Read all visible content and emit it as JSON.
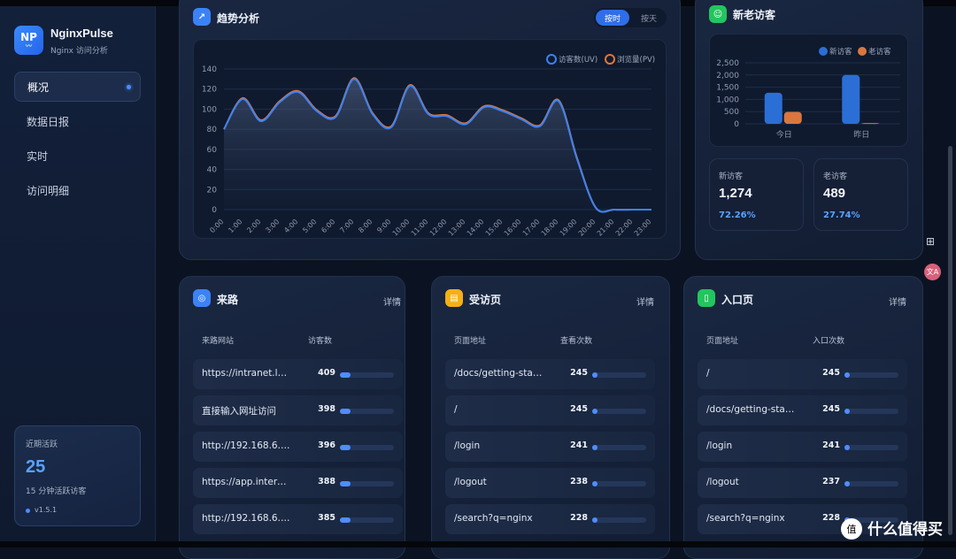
{
  "brand": {
    "logo": "NP",
    "title": "NginxPulse",
    "subtitle": "Nginx 访问分析"
  },
  "nav": [
    {
      "label": "概况",
      "active": true
    },
    {
      "label": "数据日报",
      "active": false
    },
    {
      "label": "实时",
      "active": false
    },
    {
      "label": "访问明细",
      "active": false
    }
  ],
  "recent": {
    "label": "近期活跃",
    "value": "25",
    "sub": "15 分钟活跃访客",
    "version": "v1.5.1"
  },
  "trend": {
    "title": "趋势分析",
    "seg_on": "按时",
    "seg_off": "按天"
  },
  "chart_data": {
    "type": "area",
    "legend": [
      "访客数(UV)",
      "浏览量(PV)"
    ],
    "x": [
      "0:00",
      "1:00",
      "2:00",
      "3:00",
      "4:00",
      "5:00",
      "6:00",
      "7:00",
      "8:00",
      "9:00",
      "10:00",
      "11:00",
      "12:00",
      "13:00",
      "14:00",
      "15:00",
      "16:00",
      "17:00",
      "18:00",
      "19:00",
      "20:00",
      "21:00",
      "22:00",
      "23:00"
    ],
    "ylim": [
      0,
      140
    ],
    "yticks": [
      0,
      20,
      40,
      60,
      80,
      100,
      120,
      140
    ],
    "series": [
      {
        "name": "访客数(UV)",
        "color": "#3b82f6",
        "values": [
          80,
          110,
          88,
          107,
          117,
          98,
          92,
          130,
          95,
          82,
          123,
          95,
          93,
          85,
          102,
          98,
          90,
          83,
          108,
          50,
          2,
          0,
          0,
          0
        ]
      },
      {
        "name": "浏览量(PV)",
        "color": "#e0773a",
        "values": [
          80,
          111,
          89,
          108,
          118,
          99,
          93,
          131,
          96,
          83,
          124,
          96,
          94,
          86,
          103,
          99,
          91,
          84,
          109,
          51,
          2,
          0,
          0,
          0
        ]
      }
    ]
  },
  "visitors": {
    "title": "新老访客",
    "legend_new": "新访客",
    "legend_old": "老访客",
    "chart_data": {
      "type": "bar",
      "categories": [
        "今日",
        "昨日"
      ],
      "ylim": [
        0,
        2500
      ],
      "yticks": [
        "0",
        "500",
        "1,000",
        "1,500",
        "2,000",
        "2,500"
      ],
      "series": [
        {
          "name": "新访客",
          "color": "#2b6fd6",
          "values": [
            1274,
            2000
          ]
        },
        {
          "name": "老访客",
          "color": "#d9773f",
          "values": [
            489,
            30
          ]
        }
      ]
    },
    "new": {
      "label": "新访客",
      "value": "1,274",
      "pct": "72.26%"
    },
    "old": {
      "label": "老访客",
      "value": "489",
      "pct": "27.74%"
    }
  },
  "source": {
    "title": "来路",
    "detail": "详情",
    "col1": "来路网站",
    "col2": "访客数",
    "rows": [
      {
        "name": "https://intranet.loc...",
        "value": "409",
        "fill": 0.2
      },
      {
        "name": "直接输入网址访问",
        "value": "398",
        "fill": 0.2
      },
      {
        "name": "http://192.168.6.131...",
        "value": "396",
        "fill": 0.2
      },
      {
        "name": "https://app.interna...",
        "value": "388",
        "fill": 0.2
      },
      {
        "name": "http://192.168.6.131...",
        "value": "385",
        "fill": 0.2
      }
    ]
  },
  "pages": {
    "title": "受访页",
    "detail": "详情",
    "col1": "页面地址",
    "col2": "查看次数",
    "rows": [
      {
        "name": "/docs/getting-star...",
        "value": "245",
        "fill": 0.1
      },
      {
        "name": "/",
        "value": "245",
        "fill": 0.1
      },
      {
        "name": "/login",
        "value": "241",
        "fill": 0.1
      },
      {
        "name": "/logout",
        "value": "238",
        "fill": 0.1
      },
      {
        "name": "/search?q=nginx",
        "value": "228",
        "fill": 0.1
      }
    ]
  },
  "entry": {
    "title": "入口页",
    "detail": "详情",
    "col1": "页面地址",
    "col2": "入口次数",
    "rows": [
      {
        "name": "/",
        "value": "245",
        "fill": 0.1
      },
      {
        "name": "/docs/getting-star...",
        "value": "245",
        "fill": 0.1
      },
      {
        "name": "/login",
        "value": "241",
        "fill": 0.1
      },
      {
        "name": "/logout",
        "value": "237",
        "fill": 0.1
      },
      {
        "name": "/search?q=nginx",
        "value": "228",
        "fill": 0.1
      }
    ]
  },
  "watermark": {
    "logo": "值",
    "text": "什么值得买"
  }
}
